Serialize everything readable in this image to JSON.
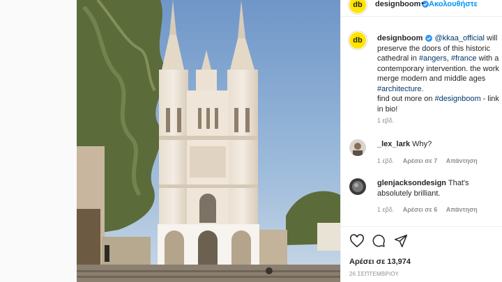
{
  "post": {
    "author": "designboom",
    "follow_label": "Ακολουθήστε",
    "caption": {
      "mention": "@kkaa_official",
      "text_1": " will preserve the doors of this historic cathedral in ",
      "tag_1": "#angers",
      "sep": ", ",
      "tag_2": "#france",
      "text_2": " with a contemporary intervention. the work merge modern and middle ages ",
      "tag_3": "#architecture",
      "text_3": ".",
      "text_4": "find out more on ",
      "mention_2": "#designboom",
      "text_5": " - link in bio!",
      "time": "1 εβδ."
    },
    "comments": [
      {
        "user": "_lex_lark",
        "text": "Why?",
        "time": "1 εβδ.",
        "likes": "Αρέσει σε 7",
        "reply": "Απάντηση"
      },
      {
        "user": "glenjacksondesign",
        "text": "That's absolutely brilliant.",
        "time": "1 εβδ.",
        "likes": "Αρέσει σε 6",
        "reply": "Απάντηση"
      }
    ],
    "likes_text": "Αρέσει σε 13,974",
    "date": "26 ΣΕΠΤΕΜΒΡΙΟΥ"
  },
  "icons": {
    "verified": "verified-badge-icon",
    "next": "chevron-right-icon",
    "like": "heart-icon",
    "comment": "comment-icon",
    "share": "share-icon"
  },
  "colors": {
    "accent": "#0095f6",
    "link": "#00376b",
    "avatar_bg": "#ffe500",
    "sky": "#8fb3d4"
  }
}
